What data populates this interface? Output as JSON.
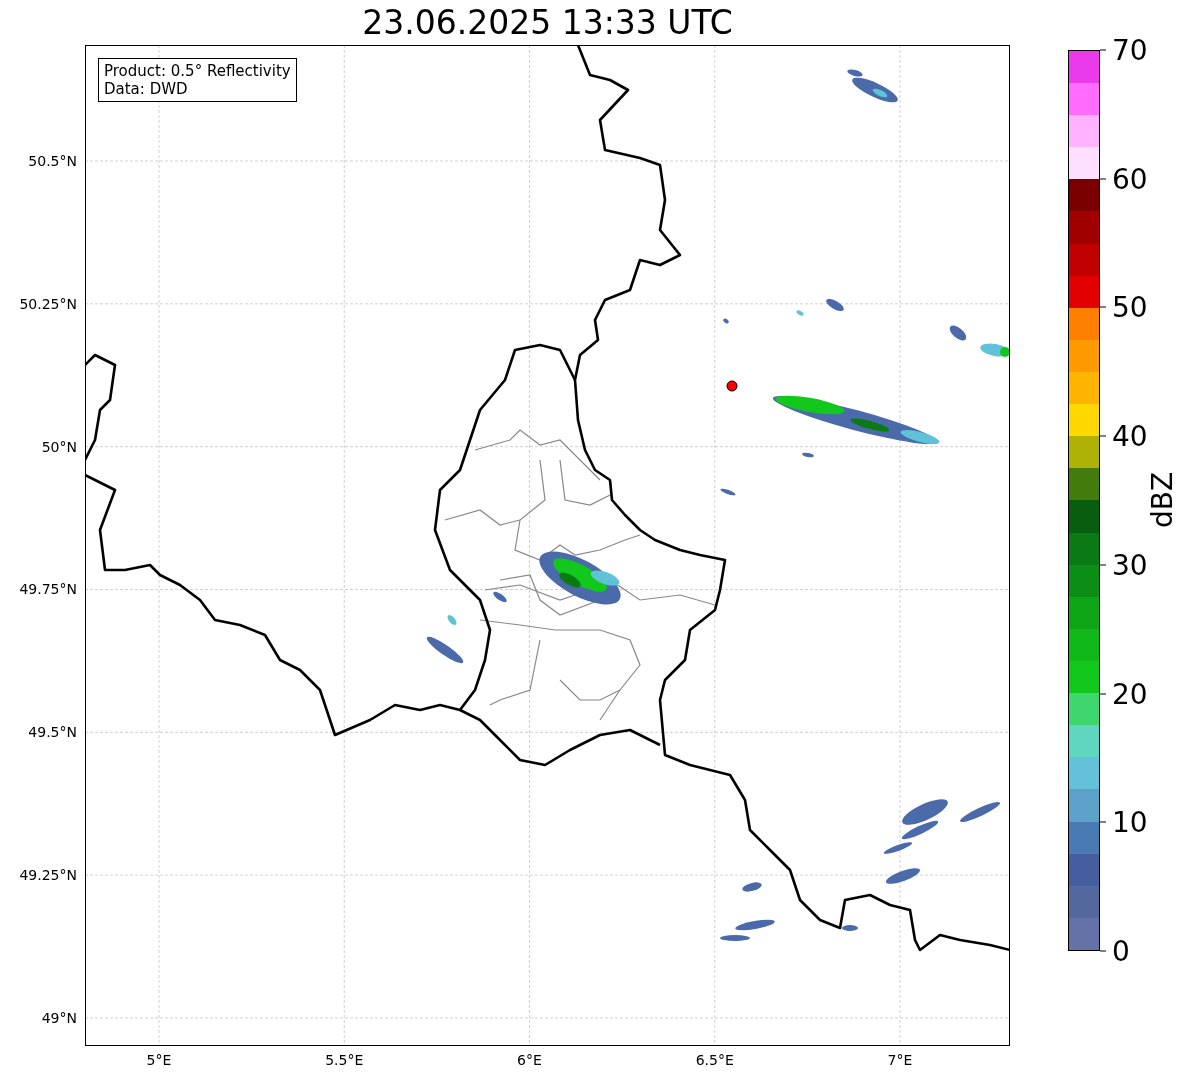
{
  "title": "23.06.2025 13:33 UTC",
  "info_box": {
    "lines": [
      "Product: 0.5° Reflectivity",
      "Data: DWD"
    ]
  },
  "map": {
    "lat_ticks": [
      "50.5°N",
      "50.25°N",
      "50°N",
      "49.75°N",
      "49.5°N",
      "49.25°N",
      "49°N"
    ],
    "lon_ticks": [
      "5°E",
      "5.5°E",
      "6°E",
      "6.5°E",
      "7°E"
    ]
  },
  "colorbar": {
    "label": "dBZ",
    "ticks": [
      "70",
      "60",
      "50",
      "40",
      "30",
      "20",
      "10",
      "0"
    ],
    "bins": [
      {
        "color": "#6373a8"
      },
      {
        "color": "#52689f"
      },
      {
        "color": "#445ea0"
      },
      {
        "color": "#4a7ab4"
      },
      {
        "color": "#5ba1c9"
      },
      {
        "color": "#64c1da"
      },
      {
        "color": "#5fd6c0"
      },
      {
        "color": "#3ed66f"
      },
      {
        "color": "#12c81c"
      },
      {
        "color": "#10b81a"
      },
      {
        "color": "#0ea517"
      },
      {
        "color": "#0c8d15"
      },
      {
        "color": "#0a7a12"
      },
      {
        "color": "#075e0e"
      },
      {
        "color": "#447b0d"
      },
      {
        "color": "#b0b105"
      },
      {
        "color": "#ffd800"
      },
      {
        "color": "#ffb400"
      },
      {
        "color": "#ff9900"
      },
      {
        "color": "#ff7f00"
      },
      {
        "color": "#e30000"
      },
      {
        "color": "#c10000"
      },
      {
        "color": "#a00000"
      },
      {
        "color": "#7a0000"
      },
      {
        "color": "#ffdfff"
      },
      {
        "color": "#ffb2ff"
      },
      {
        "color": "#ff6cff"
      },
      {
        "color": "#ea3aea"
      }
    ]
  }
}
